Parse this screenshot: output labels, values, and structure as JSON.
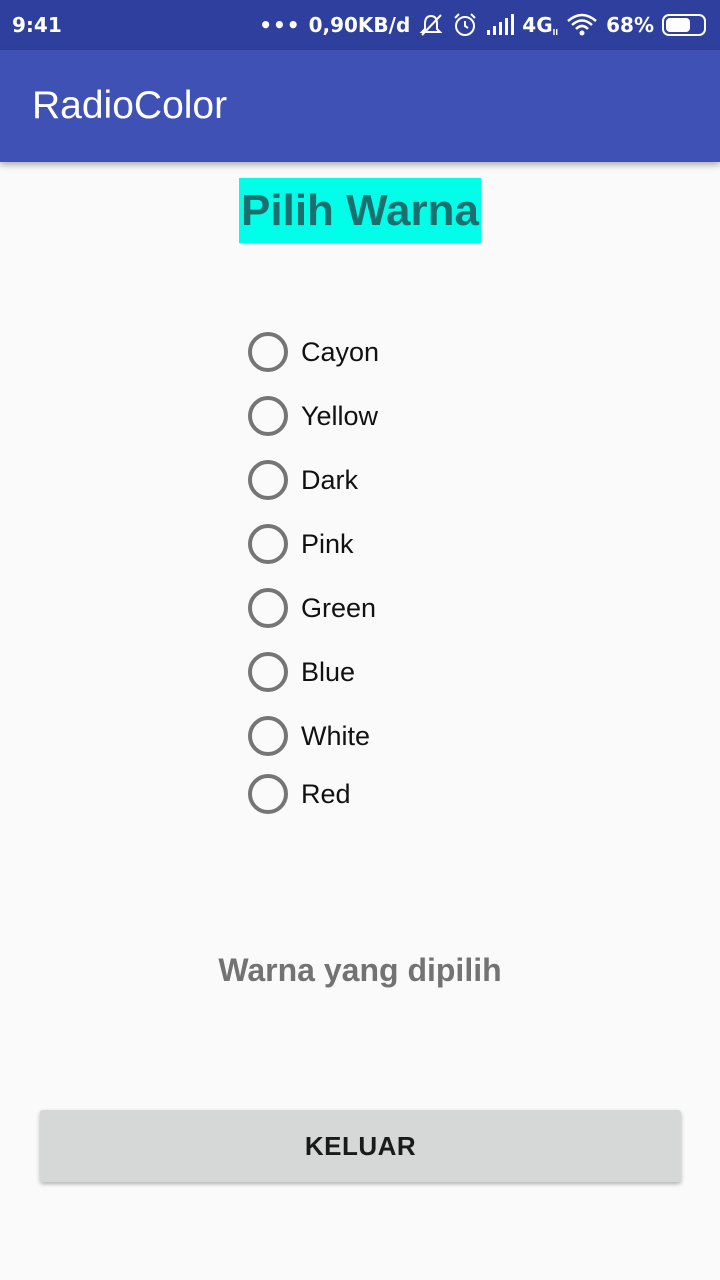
{
  "status_bar": {
    "time": "9:41",
    "more_indicator": "•••",
    "network_speed": "0,90KB/d",
    "signal_type": "4G",
    "battery_percent": "68%",
    "battery_level": 0.68,
    "icons": [
      "mute-bell-icon",
      "alarm-icon",
      "signal-icon",
      "wifi-icon",
      "battery-icon"
    ]
  },
  "app_bar": {
    "title": "RadioColor",
    "color": "#3f51b5"
  },
  "main": {
    "heading": "Pilih Warna",
    "heading_bg": "#00ffe8",
    "options": [
      {
        "label": "Cayon",
        "checked": false
      },
      {
        "label": "Yellow",
        "checked": false
      },
      {
        "label": "Dark",
        "checked": false
      },
      {
        "label": "Pink",
        "checked": false
      },
      {
        "label": "Green",
        "checked": false
      },
      {
        "label": "Blue",
        "checked": false
      },
      {
        "label": "White",
        "checked": false
      },
      {
        "label": "Red",
        "checked": false
      }
    ],
    "selected_text": "Warna yang dipilih",
    "exit_button": "KELUAR"
  }
}
